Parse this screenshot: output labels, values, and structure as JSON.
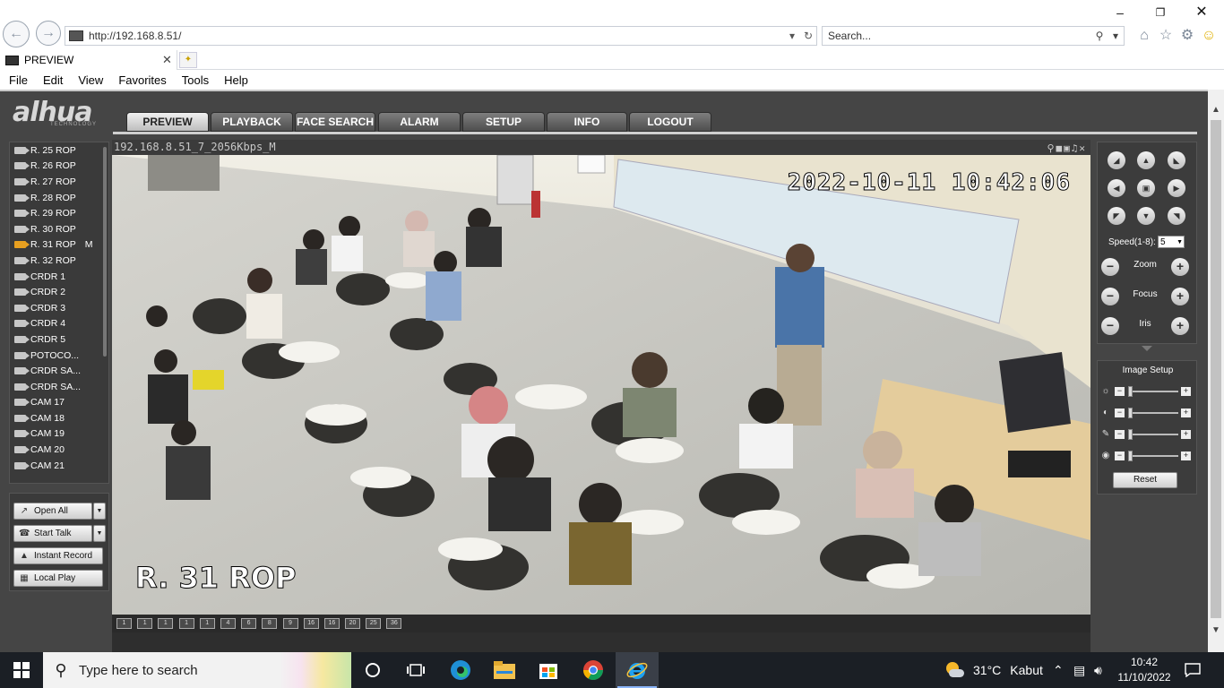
{
  "browser": {
    "url": "http://192.168.8.51/",
    "search_placeholder": "Search...",
    "tab_title": "PREVIEW",
    "menu": [
      "File",
      "Edit",
      "View",
      "Favorites",
      "Tools",
      "Help"
    ]
  },
  "app": {
    "logo": "alhua",
    "logo_sub": "TECHNOLOGY",
    "tabs": [
      "PREVIEW",
      "PLAYBACK",
      "FACE SEARCH",
      "ALARM",
      "SETUP",
      "INFO",
      "LOGOUT"
    ],
    "active_tab": "PREVIEW"
  },
  "cameras": [
    {
      "name": "R. 25 ROP",
      "active": false,
      "status": ""
    },
    {
      "name": "R. 26 ROP",
      "active": false,
      "status": ""
    },
    {
      "name": "R. 27 ROP",
      "active": false,
      "status": ""
    },
    {
      "name": "R. 28 ROP",
      "active": false,
      "status": ""
    },
    {
      "name": "R. 29 ROP",
      "active": false,
      "status": ""
    },
    {
      "name": "R. 30 ROP",
      "active": false,
      "status": ""
    },
    {
      "name": "R. 31 ROP",
      "active": true,
      "status": "M"
    },
    {
      "name": "R. 32 ROP",
      "active": false,
      "status": ""
    },
    {
      "name": "CRDR 1",
      "active": false,
      "status": ""
    },
    {
      "name": "CRDR 2",
      "active": false,
      "status": ""
    },
    {
      "name": "CRDR 3",
      "active": false,
      "status": ""
    },
    {
      "name": "CRDR 4",
      "active": false,
      "status": ""
    },
    {
      "name": "CRDR 5",
      "active": false,
      "status": ""
    },
    {
      "name": "POTOCO...",
      "active": false,
      "status": ""
    },
    {
      "name": "CRDR SA...",
      "active": false,
      "status": ""
    },
    {
      "name": "CRDR SA...",
      "active": false,
      "status": ""
    },
    {
      "name": "CAM 17",
      "active": false,
      "status": ""
    },
    {
      "name": "CAM 18",
      "active": false,
      "status": ""
    },
    {
      "name": "CAM 19",
      "active": false,
      "status": ""
    },
    {
      "name": "CAM 20",
      "active": false,
      "status": ""
    },
    {
      "name": "CAM 21",
      "active": false,
      "status": ""
    }
  ],
  "actions": {
    "open_all": "Open All",
    "start_talk": "Start Talk",
    "instant_record": "Instant Record",
    "local_play": "Local Play"
  },
  "video": {
    "stream_title": "192.168.8.51_7_2056Kbps_M",
    "osd_time": "2022-10-11 10:42:06",
    "osd_camera": "R. 31 ROP",
    "split_modes": [
      "1",
      "1",
      "1",
      "1",
      "1",
      "4",
      "6",
      "8",
      "9",
      "16",
      "16",
      "20",
      "25",
      "36"
    ]
  },
  "ptz": {
    "speed_label": "Speed(1-8):",
    "speed_value": "5",
    "zoom_label": "Zoom",
    "focus_label": "Focus",
    "iris_label": "Iris"
  },
  "image_setup": {
    "title": "Image Setup",
    "reset_label": "Reset",
    "brightness": 0.0,
    "contrast": 0.0,
    "saturation": 0.0,
    "hue": 0.0
  },
  "taskbar": {
    "search_placeholder": "Type here to search",
    "weather_temp": "31°C",
    "weather_desc": "Kabut",
    "time": "10:42",
    "date": "11/10/2022"
  }
}
